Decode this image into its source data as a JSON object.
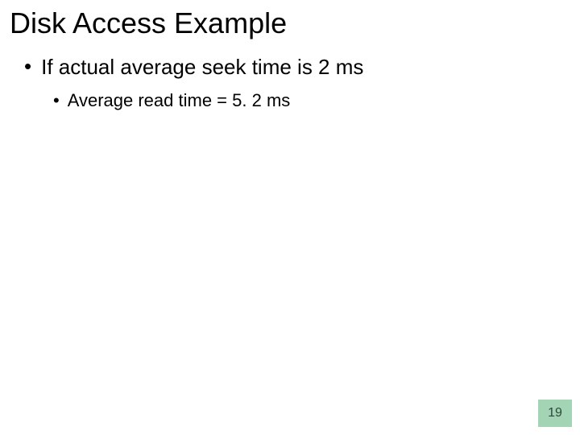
{
  "title": "Disk Access Example",
  "bullets": {
    "b1": "If actual average seek time is 2 ms",
    "b1_1": "Average read time = 5. 2 ms"
  },
  "pageNumber": "19"
}
